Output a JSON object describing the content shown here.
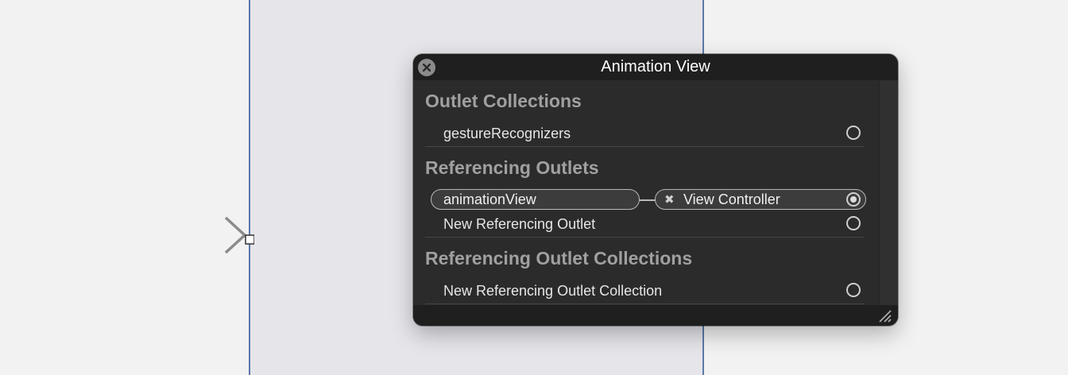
{
  "popover": {
    "title": "Animation View",
    "sections": {
      "outlet_collections": {
        "heading": "Outlet Collections",
        "rows": [
          {
            "label": "gestureRecognizers",
            "connected": false
          }
        ]
      },
      "referencing_outlets": {
        "heading": "Referencing Outlets",
        "connection": {
          "source": "animationView",
          "target": "View Controller",
          "remove_icon": "close-x-icon"
        },
        "rows": [
          {
            "label": "New Referencing Outlet",
            "connected": false
          }
        ]
      },
      "referencing_outlet_collections": {
        "heading": "Referencing Outlet Collections",
        "rows": [
          {
            "label": "New Referencing Outlet Collection",
            "connected": false
          }
        ]
      }
    }
  },
  "icons": {
    "close": "close-circle-icon",
    "entry": "entry-point-arrow-icon",
    "resize": "resize-grip-icon"
  },
  "colors": {
    "popover_bg": "#2b2b2b",
    "header_bg": "#1f1f1f",
    "heading_text": "#a0a0a0",
    "scene_border": "#5b79a8",
    "scene_bg": "#e5e5ea"
  }
}
